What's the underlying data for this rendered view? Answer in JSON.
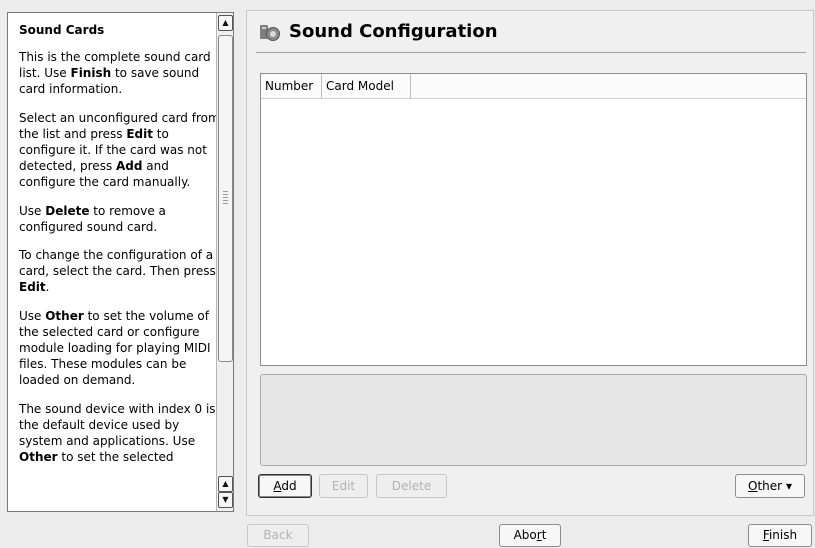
{
  "help": {
    "title": "Sound Cards",
    "p1_a": "This is the complete sound card list. Use ",
    "p1_b": "Finish",
    "p1_c": " to save sound card information.",
    "p2_a": "Select an unconfigured card from the list and press ",
    "p2_b": "Edit",
    "p2_c": " to configure it. If the card was not detected, press ",
    "p2_d": "Add",
    "p2_e": " and configure the card manually.",
    "p3_a": "Use ",
    "p3_b": "Delete",
    "p3_c": " to remove a configured sound card.",
    "p4_a": "To change the configuration of a card, select the card. Then press ",
    "p4_b": "Edit",
    "p4_c": ".",
    "p5_a": "Use ",
    "p5_b": "Other",
    "p5_c": " to set the volume of the selected card or configure module loading for playing MIDI files. These modules can be loaded on demand.",
    "p6_a": "The sound device with index 0 is the default device used by system and applications. Use ",
    "p6_b": "Other",
    "p6_c": " to set the selected"
  },
  "main": {
    "title": "Sound Configuration",
    "table": {
      "columns": [
        "Number",
        "Card Model"
      ]
    },
    "buttons": {
      "add": "A",
      "add_rest": "dd",
      "edit": "Edit",
      "delete": "Delete",
      "other": "O",
      "other_rest": "ther",
      "other_arrow": "▾"
    }
  },
  "nav": {
    "back": "Back",
    "abort_a": "Abo",
    "abort_u": "r",
    "abort_b": "t",
    "finish_u": "F",
    "finish_rest": "inish"
  },
  "colors": {
    "accent": "#7a7a7a"
  }
}
